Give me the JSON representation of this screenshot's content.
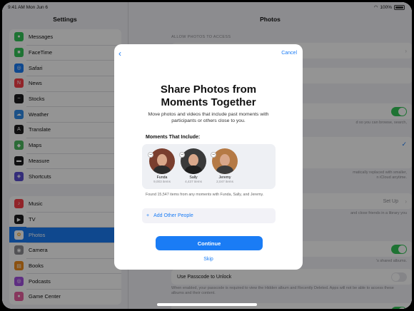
{
  "status": {
    "time": "9:41 AM  Mon Jun 6",
    "battery": "100%"
  },
  "sidebar": {
    "title": "Settings",
    "group1": [
      {
        "label": "Messages",
        "icon": "messages-icon",
        "color": "#34c759",
        "glyph": "●"
      },
      {
        "label": "FaceTime",
        "icon": "facetime-icon",
        "color": "#34c759",
        "glyph": "■"
      },
      {
        "label": "Safari",
        "icon": "safari-icon",
        "color": "#1a7cf5",
        "glyph": "◎"
      },
      {
        "label": "News",
        "icon": "news-icon",
        "color": "#fa3e48",
        "glyph": "N"
      },
      {
        "label": "Stocks",
        "icon": "stocks-icon",
        "color": "#1c1c1e",
        "glyph": "~"
      },
      {
        "label": "Weather",
        "icon": "weather-icon",
        "color": "#2f8ce8",
        "glyph": "☁"
      },
      {
        "label": "Translate",
        "icon": "translate-icon",
        "color": "#1c1c1e",
        "glyph": "A"
      },
      {
        "label": "Maps",
        "icon": "maps-icon",
        "color": "#4cb860",
        "glyph": "◆"
      },
      {
        "label": "Measure",
        "icon": "measure-icon",
        "color": "#1c1c1e",
        "glyph": "▬"
      },
      {
        "label": "Shortcuts",
        "icon": "shortcuts-icon",
        "color": "#5a4fd1",
        "glyph": "◈"
      }
    ],
    "group2": [
      {
        "label": "Music",
        "icon": "music-icon",
        "color": "#fa3e48",
        "glyph": "♪"
      },
      {
        "label": "TV",
        "icon": "tv-icon",
        "color": "#1c1c1e",
        "glyph": "▶"
      },
      {
        "label": "Photos",
        "icon": "photos-icon",
        "color": "#ffffff",
        "glyph": "✿",
        "selected": true
      },
      {
        "label": "Camera",
        "icon": "camera-icon",
        "color": "#8e8e93",
        "glyph": "◉"
      },
      {
        "label": "Books",
        "icon": "books-icon",
        "color": "#f08c1a",
        "glyph": "▤"
      },
      {
        "label": "Podcasts",
        "icon": "podcasts-icon",
        "color": "#a350e0",
        "glyph": "◎"
      },
      {
        "label": "Game Center",
        "icon": "game-center-icon",
        "color": "#e85fa0",
        "glyph": "●"
      }
    ]
  },
  "main": {
    "title": "Photos",
    "allow_header": "ALLOW PHOTOS TO ACCESS",
    "bg_text_1": "d so you can browse, search,",
    "bg_text_2": "matically replaced with smaller,",
    "bg_text_3": "n iCloud anytime.",
    "setup_label": "Set Up",
    "bg_text_4": "and close friends in a library you",
    "bg_text_5": "'s shared albums.",
    "passcode_label": "Use Passcode to Unlock",
    "passcode_footer": "When enabled, your passcode is required to view the Hidden album and Recently Deleted. Apps will not be able to access these albums and their content."
  },
  "modal": {
    "back_glyph": "‹",
    "cancel_label": "Cancel",
    "title_line1": "Share Photos from",
    "title_line2": "Moments Together",
    "description": "Move photos and videos that include past moments with participants or others close to you.",
    "section_label": "Moments That Include:",
    "people": [
      {
        "name": "Funda",
        "count": "9,003 items",
        "bg": "#7a3e2e",
        "body": "#2b2b2b"
      },
      {
        "name": "Sally",
        "count": "4,437 items",
        "bg": "#3a3a3a",
        "body": "#1e1e1e"
      },
      {
        "name": "Jeremy",
        "count": "2,047 items",
        "bg": "#b57a45",
        "body": "#3c3c3c"
      }
    ],
    "found_text": "Found 15,547 items from any moments with Funda, Sally, and Jeremy.",
    "add_people_label": "Add Other People",
    "continue_label": "Continue",
    "skip_label": "Skip"
  }
}
